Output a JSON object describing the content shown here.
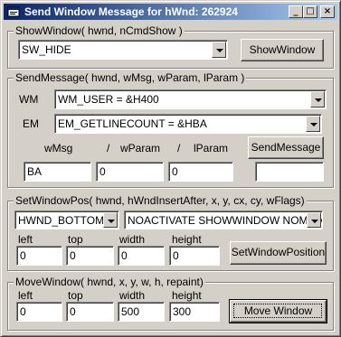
{
  "window": {
    "title": "Send Window Message for hWnd: 262924",
    "minimize": "_",
    "maximize": "□",
    "close": "×"
  },
  "show_window": {
    "caption": "ShowWindow( hwnd,  nCmdShow )",
    "cmd_show_value": "SW_HIDE",
    "button_label": "ShowWindow"
  },
  "send_message": {
    "caption": "SendMessage( hwnd, wMsg, wParam, lParam )",
    "wm_label": "WM",
    "wm_value": "WM_USER = &H400",
    "em_label": "EM",
    "em_value": "EM_GETLINECOUNT = &HBA",
    "wmsg_label": "wMsg",
    "slash1": "/",
    "wparam_label": "wParam",
    "slash2": "/",
    "lparam_label": "lParam",
    "button_label": "SendMessage",
    "wmsg_value": "BA",
    "wparam_value": "0",
    "lparam_value": "0",
    "result_value": ""
  },
  "set_window_pos": {
    "caption": "SetWindowPos( hwnd, hWndInsertAfter, x, y, cx, cy, wFlags)",
    "insert_after_value": "HWND_BOTTOM =",
    "flags_value": "NOACTIVATE SHOWWINDOW NOMOVE",
    "left_label": "left",
    "top_label": "top",
    "width_label": "width",
    "height_label": "height",
    "left_value": "0",
    "top_value": "0",
    "width_value": "0",
    "height_value": "0",
    "button_label": "SetWindowPosition"
  },
  "move_window": {
    "caption": "MoveWindow( hwnd, x, y, w, h, repaint)",
    "left_label": "left",
    "top_label": "top",
    "width_label": "width",
    "height_label": "height",
    "left_value": "0",
    "top_value": "0",
    "width_value": "500",
    "height_value": "300",
    "button_label": "Move Window"
  }
}
